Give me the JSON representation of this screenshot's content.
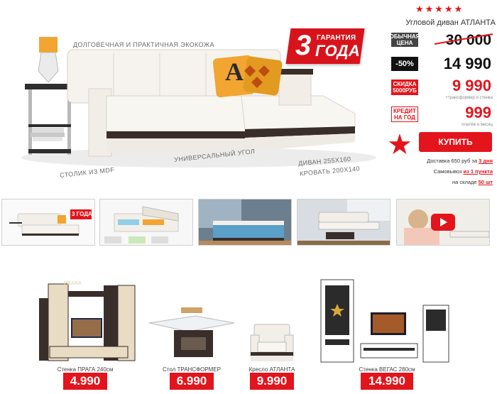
{
  "hero": {
    "captions": {
      "ecoleather": "ДОЛГОВЕЧНАЯ И ПРАКТИЧНАЯ ЭКОКОЖА",
      "table": "СТОЛИК ИЗ MDF",
      "corner": "УНИВЕРСАЛЬНЫЙ УГОЛ",
      "sofa_size": "ДИВАН 255х160",
      "bed_size": "КРОВАТЬ 200х140"
    },
    "guarantee": {
      "number": "3",
      "word1": "ГАРАНТИЯ",
      "word2": "ГОДА"
    },
    "pillow_letter": "A"
  },
  "panel": {
    "stars": "★★★★★",
    "title": "Угловой диван АТЛАНТА",
    "regular_label": "ОБЫЧНАЯ ЦЕНА",
    "regular_price": "30 000",
    "discount_label": "-50%",
    "discount_price": "14 990",
    "skidka_label": "СКИДКА 5000РУБ",
    "skidka_price": "9 990",
    "skidka_note": "+трансформер и стенка",
    "credit_label": "КРЕДИТ НА ГОД",
    "credit_price": "999",
    "credit_note": "платёж в месяц",
    "buy_label": "КУПИТЬ",
    "delivery_text": "Доставка 650 руб за ",
    "delivery_days": "3 дня",
    "pickup_text": "Самовывоз ",
    "pickup_points": "из 1 пункта",
    "stock_text": "на складе ",
    "stock_count": "50 шт"
  },
  "thumbnails": [
    {
      "guarantee": "3 ГОДА"
    },
    {},
    {},
    {},
    {
      "icon": "play-icon"
    }
  ],
  "related": [
    {
      "name": "Стенка ПРАГА 240см",
      "price": "4.990",
      "sign": "PRAHA"
    },
    {
      "name": "Стол ТРАНСФОРМЕР",
      "price": "6.990"
    },
    {
      "name": "Кресло АТЛАНТА",
      "price": "9.990"
    },
    {
      "name": "Стенка ВЕГАС 280см",
      "price": "14.990"
    }
  ],
  "colors": {
    "accent": "#e3141c",
    "dark_wood": "#3a2e2a",
    "light_wood": "#e8dcc4",
    "leather": "#f3efe8"
  }
}
